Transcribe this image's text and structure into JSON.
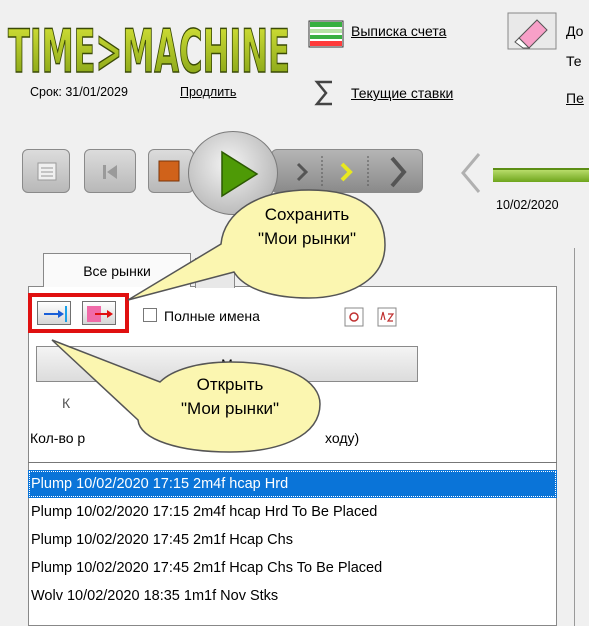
{
  "app": {
    "logo_text": "TIME>MACHINE",
    "expiry_label": "Срок: 31/01/2029",
    "renew_link": "Продлить"
  },
  "header": {
    "statement_link": "Выписка счета",
    "rates_link": "Текущие ставки",
    "do_link": "До",
    "te_label": "Те",
    "pe_link": "Пе"
  },
  "timeline": {
    "date": "10/02/2020"
  },
  "tabs": {
    "all_markets": "Все рынки"
  },
  "options": {
    "full_names_label": "Полные имена",
    "full_names_checked": false,
    "wide_button_label": "М",
    "k_label": "К",
    "count_label_start": "Кол-во р",
    "count_label_end": "ходу)"
  },
  "callouts": {
    "save": {
      "line1": "Сохранить",
      "line2": "\"Мои рынки\""
    },
    "open": {
      "line1": "Открыть",
      "line2": "\"Мои рынки\""
    }
  },
  "markets": [
    {
      "label": "Plump 10/02/2020 17:15 2m4f hcap Hrd",
      "selected": true
    },
    {
      "label": "Plump 10/02/2020 17:15 2m4f hcap Hrd To Be Placed",
      "selected": false
    },
    {
      "label": "Plump 10/02/2020 17:45 2m1f Hcap Chs",
      "selected": false
    },
    {
      "label": "Plump 10/02/2020 17:45 2m1f Hcap Chs To Be Placed",
      "selected": false
    },
    {
      "label": "Wolv 10/02/2020 18:35 1m1f Nov Stks",
      "selected": false
    }
  ],
  "colors": {
    "highlight_frame": "#e01010",
    "selection": "#0a74d8",
    "play_arrow": "#4e9a06",
    "bubble_fill": "#fbf6b0"
  }
}
